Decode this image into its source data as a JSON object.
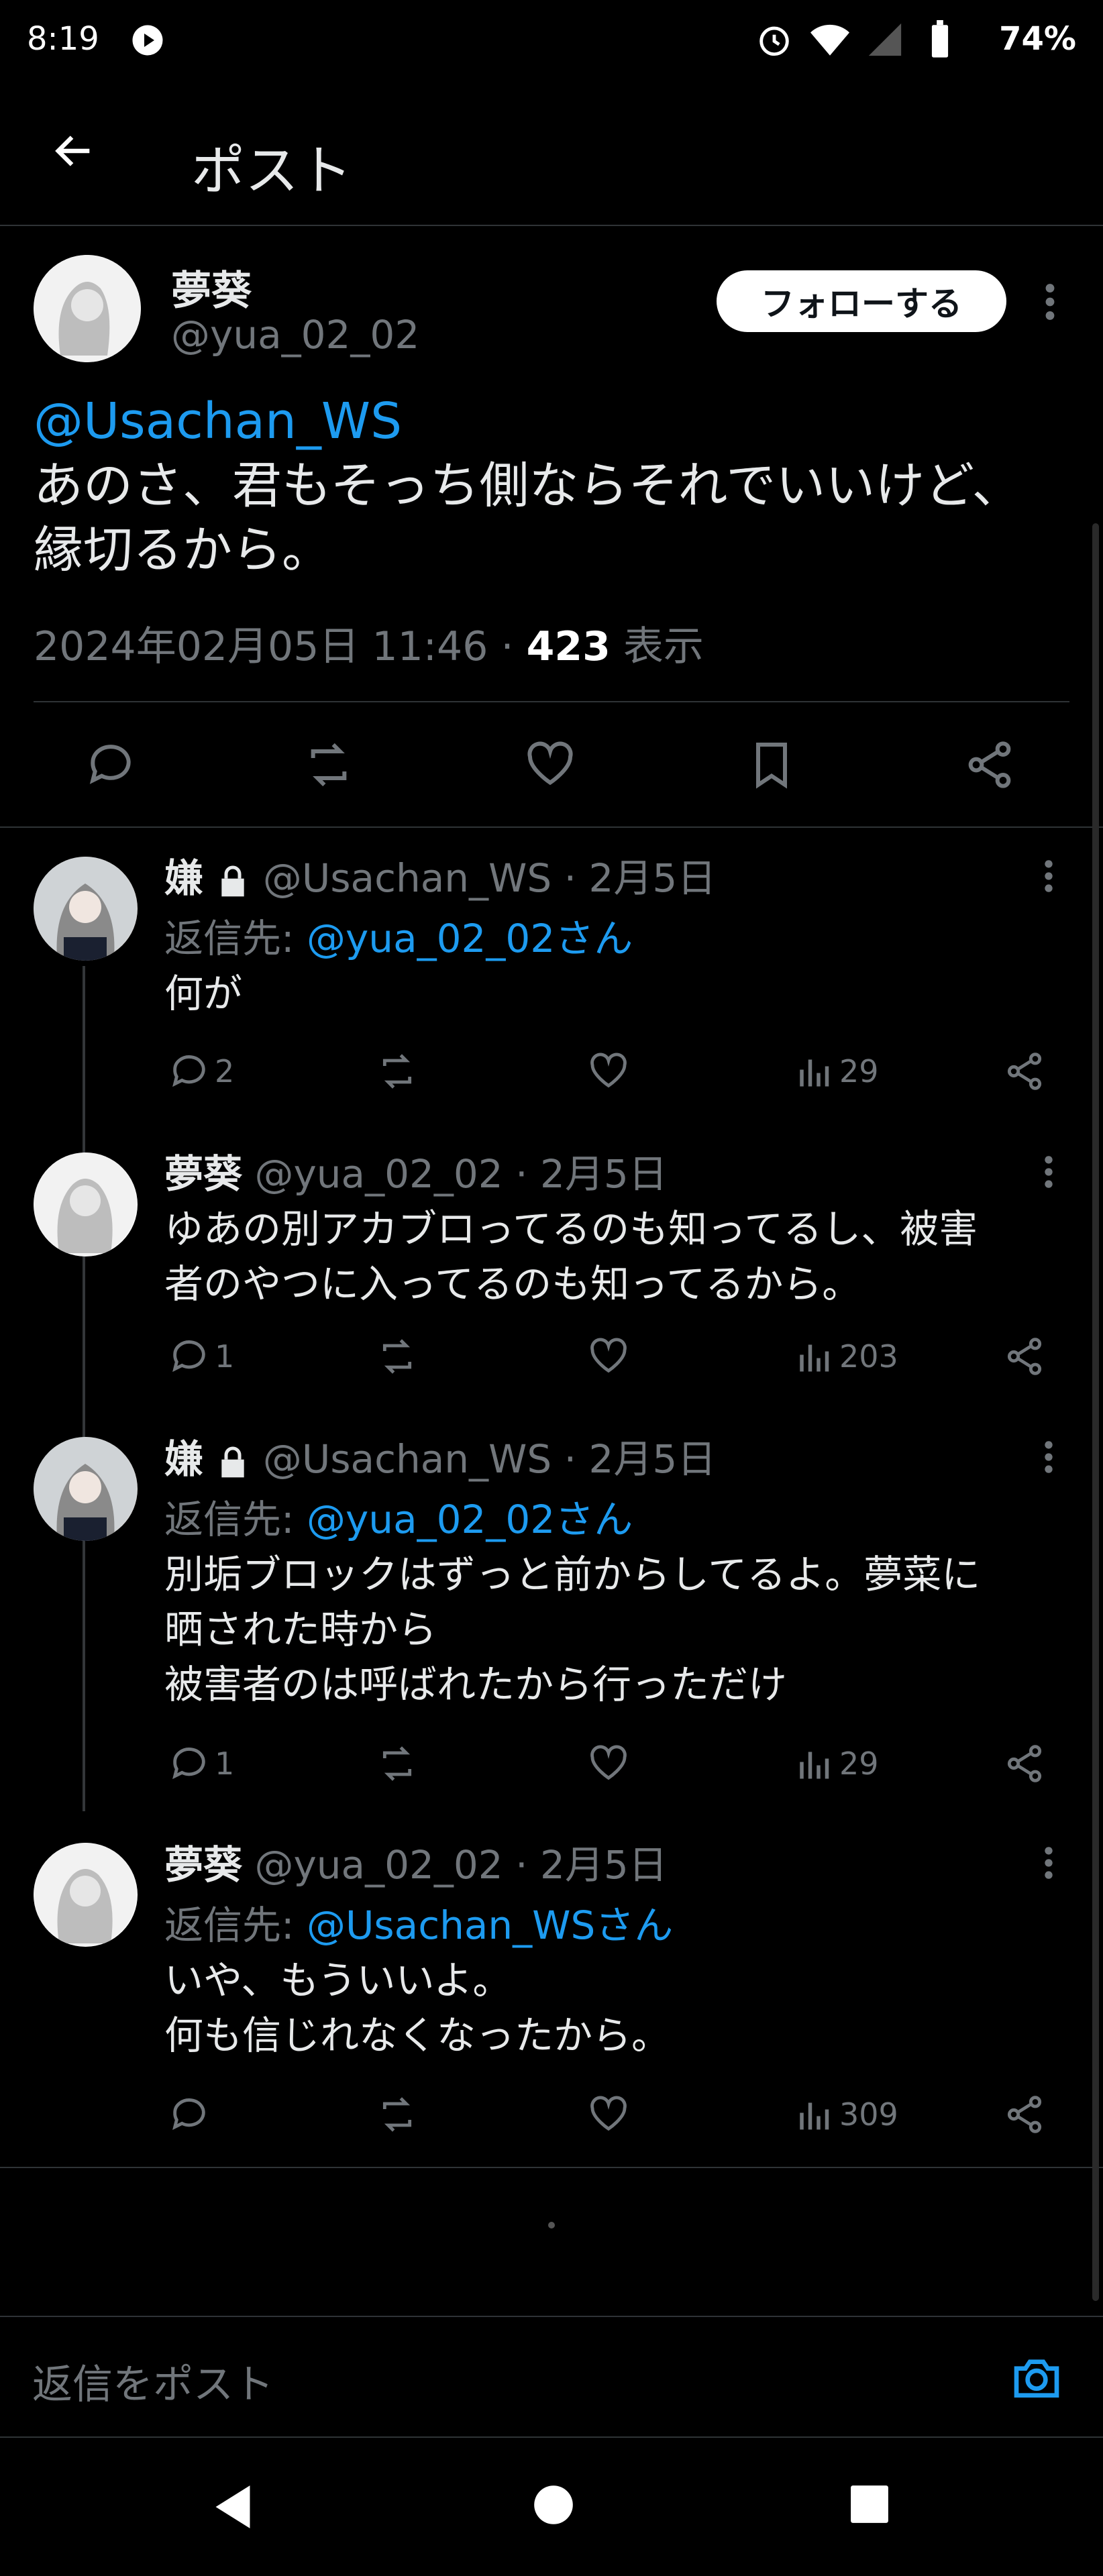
{
  "status_bar": {
    "time": "8:19",
    "battery": "74%"
  },
  "header": {
    "title": "ポスト"
  },
  "main_post": {
    "name": "夢葵",
    "handle": "@yua_02_02",
    "follow_label": "フォローする",
    "mention": "@Usachan_WS",
    "text_line1": "あのさ、君もそっち側ならそれでいいけど、",
    "text_line2": "縁切るから。",
    "timestamp": "2024年02月05日 11:46 · ",
    "views_count": "423",
    "views_label": " 表示"
  },
  "replies": [
    {
      "name": "嫌",
      "handle": "@Usachan_WS · 2月5日",
      "reply_prefix": "返信先: ",
      "reply_to": "@yua_02_02さん",
      "lines": [
        "何が"
      ],
      "replies": "2",
      "views": "29"
    },
    {
      "name": "夢葵",
      "handle": "@yua_02_02 · 2月5日",
      "lines": [
        "ゆあの別アカブロってるのも知ってるし、被害",
        "者のやつに入ってるのも知ってるから。"
      ],
      "replies": "1",
      "views": "203"
    },
    {
      "name": "嫌",
      "handle": "@Usachan_WS · 2月5日",
      "reply_prefix": "返信先: ",
      "reply_to": "@yua_02_02さん",
      "lines": [
        "別垢ブロックはずっと前からしてるよ。夢菜に",
        "晒された時から",
        "被害者のは呼ばれたから行っただけ"
      ],
      "replies": "1",
      "views": "29"
    },
    {
      "name": "夢葵",
      "handle": "@yua_02_02 · 2月5日",
      "reply_prefix": "返信先: ",
      "reply_to": "@Usachan_WSさん",
      "lines": [
        "いや、もういいよ。",
        "何も信じれなくなったから。"
      ],
      "replies": "",
      "views": "309"
    }
  ],
  "compose": {
    "placeholder": "返信をポスト"
  },
  "colors": {
    "background": "#000000",
    "link": "#1d9bf0",
    "muted": "#71767b",
    "divider": "#2f3336"
  }
}
